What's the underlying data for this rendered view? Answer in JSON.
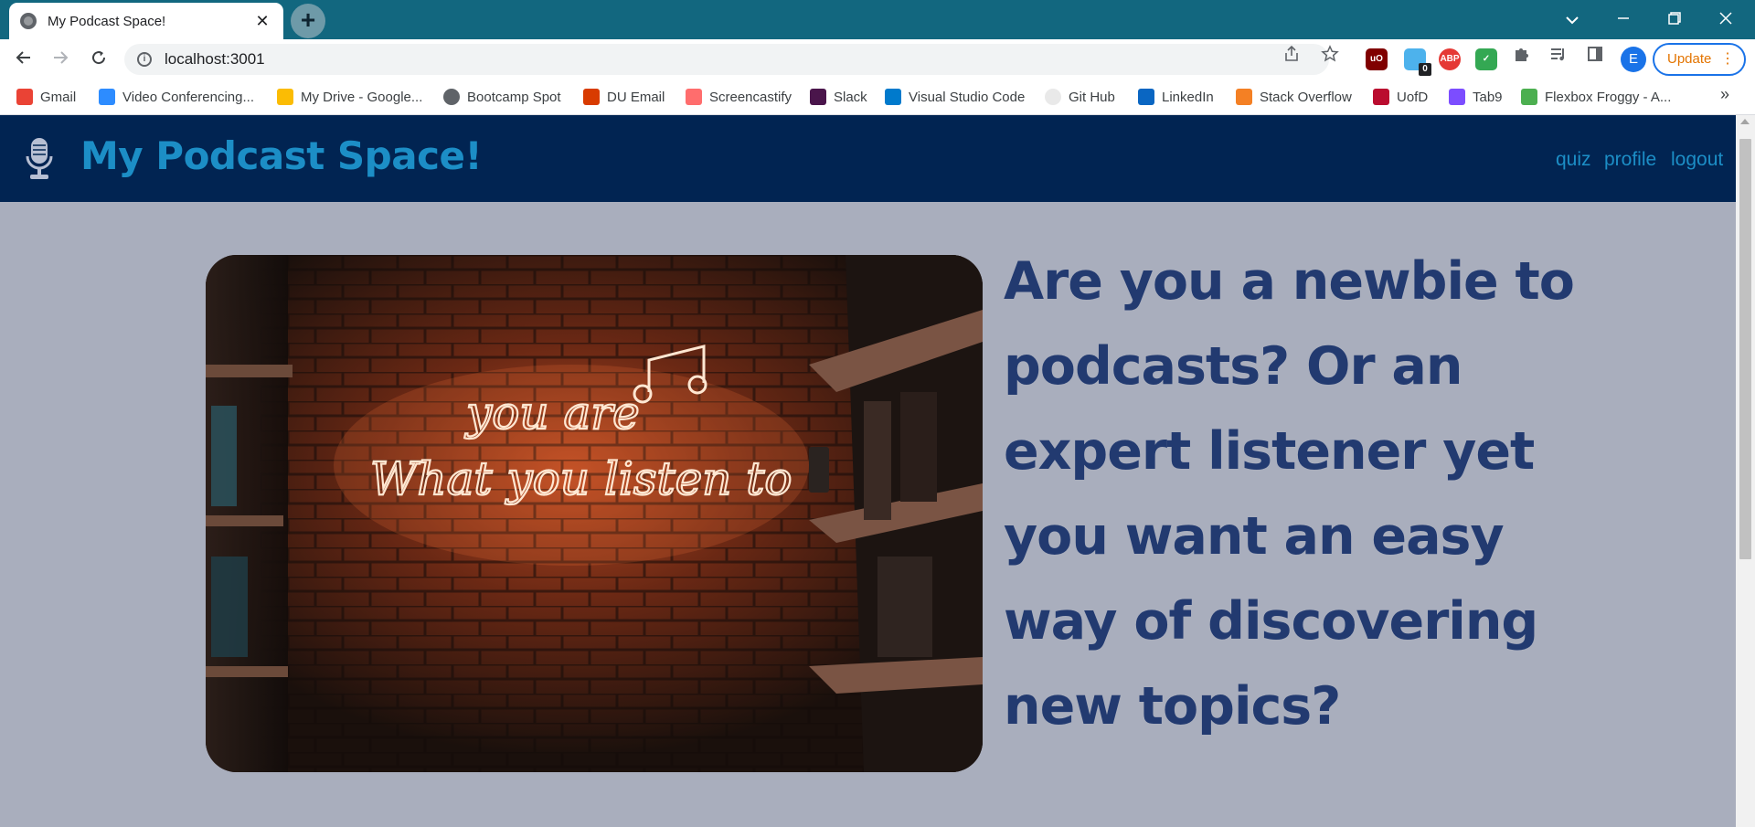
{
  "browser": {
    "tab_title": "My Podcast Space!",
    "new_tab_glyph": "+",
    "close_glyph": "✕",
    "url": "localhost:3001",
    "update_label": "Update",
    "profile_initial": "E",
    "extension_badge": "0",
    "bookmarks": [
      {
        "label": "Gmail",
        "icon": "gmail-icon",
        "color": "#ea4335"
      },
      {
        "label": "Video Conferencing...",
        "icon": "zoom-icon",
        "color": "#2d8cff"
      },
      {
        "label": "My Drive - Google...",
        "icon": "google-drive-icon",
        "color": "#fbbc04"
      },
      {
        "label": "Bootcamp Spot",
        "icon": "globe-icon",
        "color": "#5f6368"
      },
      {
        "label": "DU Email",
        "icon": "office-icon",
        "color": "#d83b01"
      },
      {
        "label": "Screencastify",
        "icon": "screencastify-icon",
        "color": "#ff6d6d"
      },
      {
        "label": "Slack",
        "icon": "slack-icon",
        "color": "#4a154b"
      },
      {
        "label": "Visual Studio Code",
        "icon": "vscode-icon",
        "color": "#007acc"
      },
      {
        "label": "Git Hub",
        "icon": "github-icon",
        "color": "#e9e9e9"
      },
      {
        "label": "LinkedIn",
        "icon": "linkedin-icon",
        "color": "#0a66c2"
      },
      {
        "label": "Stack Overflow",
        "icon": "stackoverflow-icon",
        "color": "#f48024"
      },
      {
        "label": "UofD",
        "icon": "uofd-icon",
        "color": "#ba0c2f"
      },
      {
        "label": "Tab9",
        "icon": "tab9-icon",
        "color": "#7c4dff"
      },
      {
        "label": "Flexbox Froggy - A...",
        "icon": "frog-icon",
        "color": "#4caf50"
      }
    ],
    "bookmarks_overflow": "»"
  },
  "site": {
    "title": "My Podcast Space!",
    "nav": {
      "quiz": "quiz",
      "profile": "profile",
      "logout": "logout"
    },
    "hero_lines": [
      "Are you a newbie to",
      "podcasts? Or an",
      "expert listener yet",
      "you want an easy",
      "way of discovering",
      "new topics?"
    ],
    "neon_sign": {
      "line1": "you are",
      "line2": "What you listen to"
    }
  },
  "colors": {
    "header_bg": "#012452",
    "brand_accent": "#1c8ec6",
    "hero_text": "#223a70",
    "page_bg": "#a9aebd",
    "tabstrip": "#12677f"
  }
}
